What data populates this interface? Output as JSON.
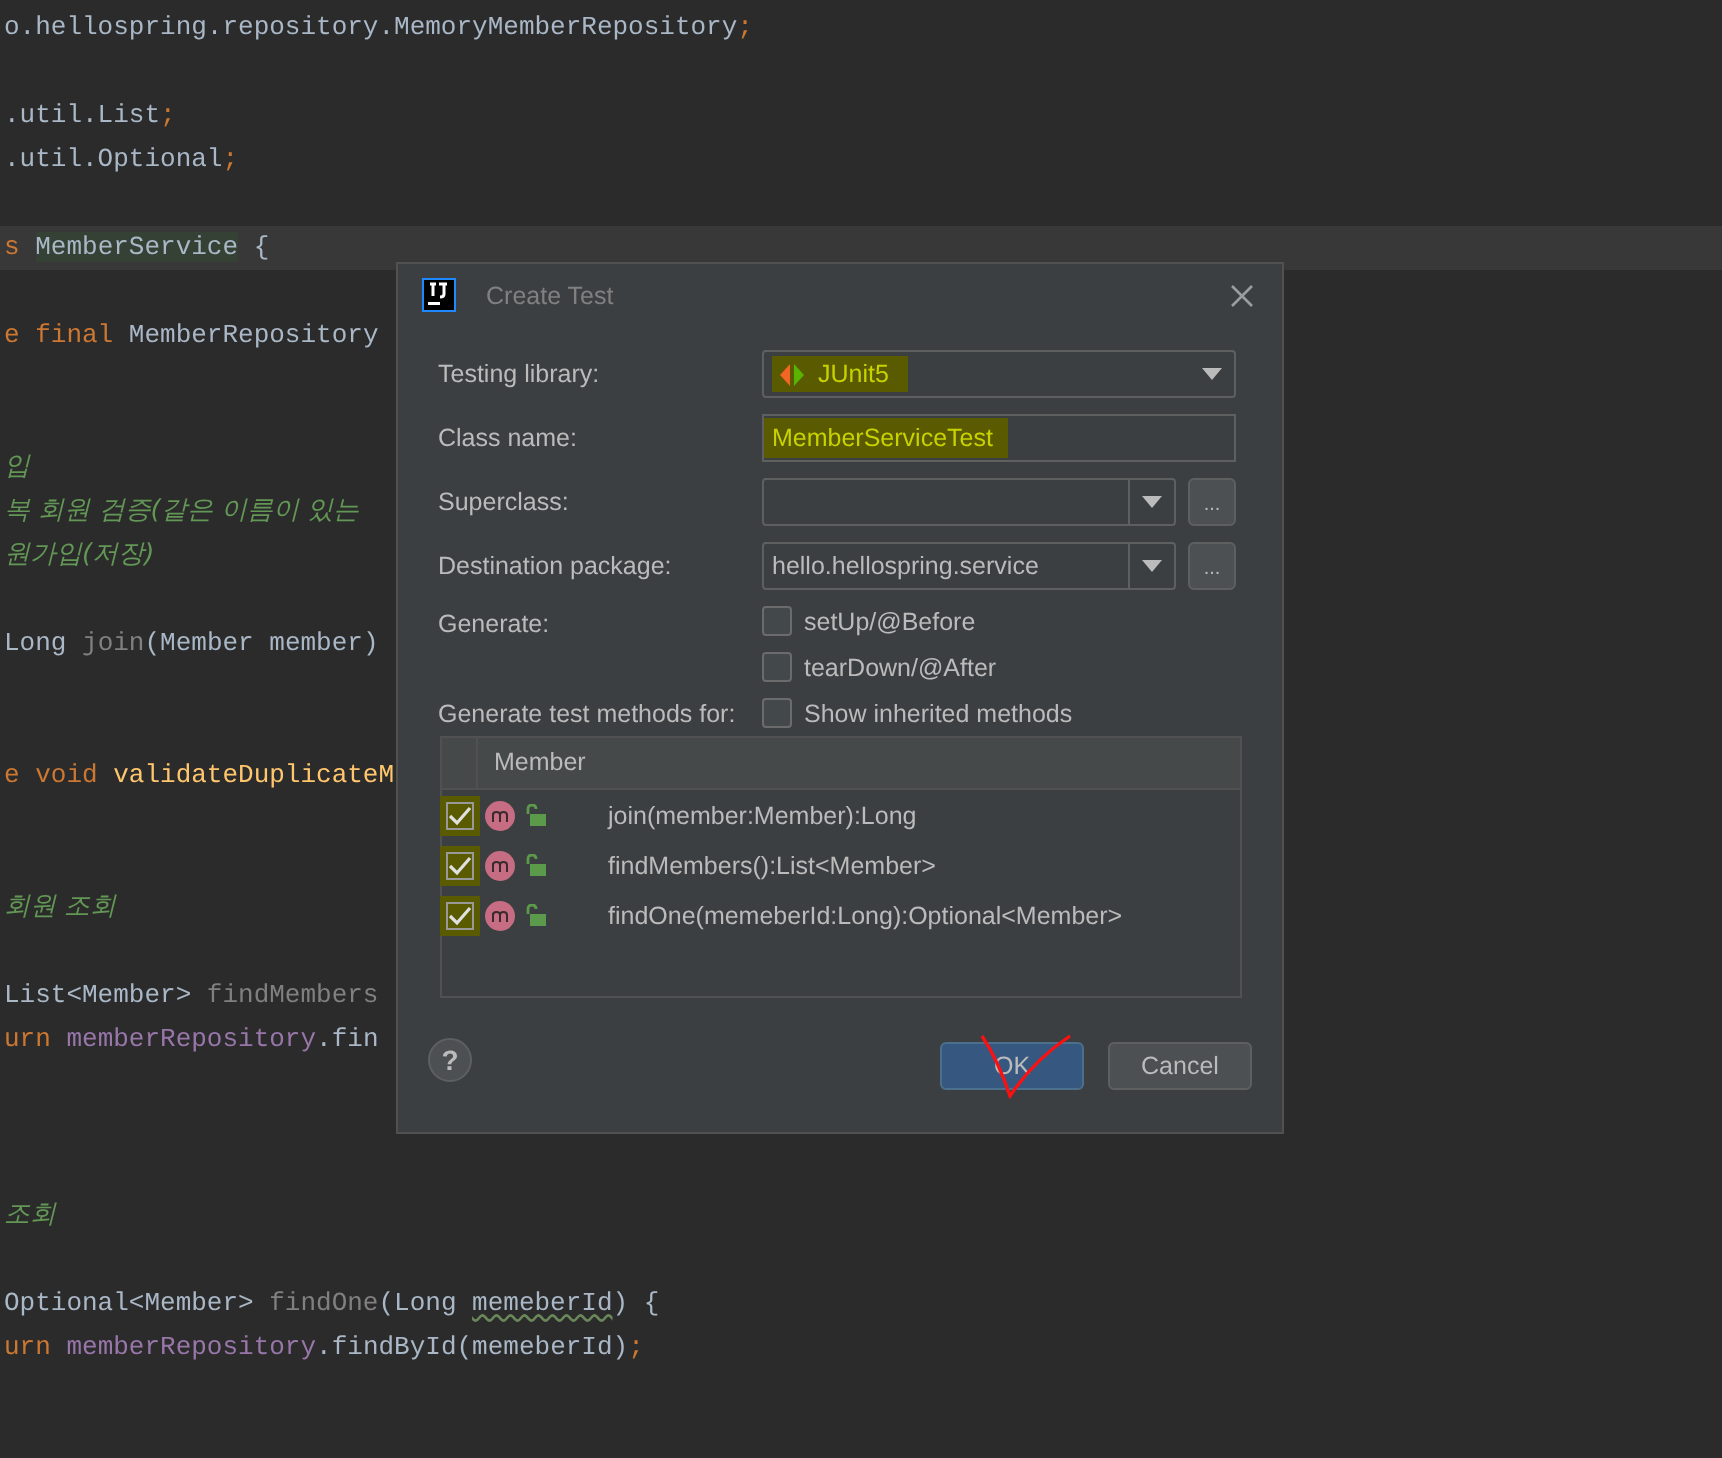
{
  "editor": {
    "lines": [
      {
        "current": false,
        "tokens": [
          {
            "text": "o.hellospring.repository.MemoryMemberRepository",
            "kind": "plain"
          },
          {
            "text": ";",
            "kind": "keyword"
          }
        ]
      },
      {
        "current": false
      },
      {
        "current": false,
        "tokens": [
          {
            "text": ".util.List",
            "kind": "plain"
          },
          {
            "text": ";",
            "kind": "keyword"
          }
        ]
      },
      {
        "current": false,
        "tokens": [
          {
            "text": ".util.Optional",
            "kind": "plain"
          },
          {
            "text": ";",
            "kind": "keyword"
          }
        ]
      },
      {
        "current": false
      },
      {
        "current": true,
        "tokens": [
          {
            "text": "s ",
            "kind": "keyword"
          },
          {
            "text": "MemberService",
            "kind": "marked"
          },
          {
            "text": " {",
            "kind": "plain"
          }
        ]
      },
      {
        "current": false
      },
      {
        "current": false,
        "tokens": [
          {
            "text": "e final ",
            "kind": "keyword"
          },
          {
            "text": "MemberRepository",
            "kind": "plain"
          }
        ]
      },
      {
        "current": false
      },
      {
        "current": false
      },
      {
        "current": false,
        "tokens": [
          {
            "text": "입",
            "kind": "comment"
          }
        ]
      },
      {
        "current": false,
        "tokens": [
          {
            "text": "복 회원 검증(같은 이름이 있는",
            "kind": "comment"
          }
        ]
      },
      {
        "current": false,
        "tokens": [
          {
            "text": "원가입(저장)",
            "kind": "comment"
          }
        ]
      },
      {
        "current": false
      },
      {
        "current": false,
        "tokens": [
          {
            "text": "Long ",
            "kind": "plain"
          },
          {
            "text": "join",
            "kind": "unused"
          },
          {
            "text": "(Member member)",
            "kind": "plain"
          }
        ]
      },
      {
        "current": false
      },
      {
        "current": false
      },
      {
        "current": false,
        "tokens": [
          {
            "text": "e void ",
            "kind": "keyword"
          },
          {
            "text": "validateDuplicateM",
            "kind": "method"
          }
        ]
      },
      {
        "current": false
      },
      {
        "current": false
      },
      {
        "current": false,
        "tokens": [
          {
            "text": "회원 조회",
            "kind": "comment"
          }
        ]
      },
      {
        "current": false
      },
      {
        "current": false,
        "tokens": [
          {
            "text": "List<Member> ",
            "kind": "plain"
          },
          {
            "text": "findMembers",
            "kind": "unused"
          }
        ]
      },
      {
        "current": false,
        "tokens": [
          {
            "text": "urn ",
            "kind": "keyword"
          },
          {
            "text": "memberRepository",
            "kind": "field"
          },
          {
            "text": ".fin",
            "kind": "plain"
          }
        ]
      },
      {
        "current": false
      },
      {
        "current": false
      },
      {
        "current": false
      },
      {
        "current": false,
        "tokens": [
          {
            "text": "조회",
            "kind": "comment"
          }
        ]
      },
      {
        "current": false
      },
      {
        "current": false,
        "tokens": [
          {
            "text": "Optional<Member> ",
            "kind": "plain"
          },
          {
            "text": "findOne",
            "kind": "unused"
          },
          {
            "text": "(Long ",
            "kind": "plain"
          },
          {
            "text": "memeberId",
            "kind": "typo"
          },
          {
            "text": ") {",
            "kind": "plain"
          }
        ]
      },
      {
        "current": false,
        "tokens": [
          {
            "text": "urn ",
            "kind": "keyword"
          },
          {
            "text": "memberRepository",
            "kind": "field"
          },
          {
            "text": ".findById(memeberId)",
            "kind": "plain"
          },
          {
            "text": ";",
            "kind": "keyword"
          }
        ]
      }
    ]
  },
  "dialog": {
    "title": "Create Test",
    "testing_library": {
      "label": "Testing library:",
      "value": "JUnit5"
    },
    "class_name": {
      "label": "Class name:",
      "value": "MemberServiceTest"
    },
    "superclass": {
      "label": "Superclass:",
      "browse": "..."
    },
    "destination_package": {
      "label": "Destination package:",
      "value": "hello.hellospring.service",
      "browse": "..."
    },
    "generate": {
      "label": "Generate:",
      "options": [
        {
          "label": "setUp/@Before",
          "checked": false
        },
        {
          "label": "tearDown/@After",
          "checked": false
        }
      ]
    },
    "methods_label": "Generate test methods for:",
    "show_inherited": {
      "label": "Show inherited methods",
      "checked": false
    },
    "table": {
      "column": "Member",
      "rows": [
        {
          "name": "join(member:Member):Long",
          "checked": true
        },
        {
          "name": "findMembers():List<Member>",
          "checked": true
        },
        {
          "name": "findOne(memeberId:Long):Optional<Member>",
          "checked": true
        }
      ]
    },
    "help": "?",
    "buttons": [
      {
        "label": "OK",
        "kind": "primary"
      },
      {
        "label": "Cancel",
        "kind": "secondary"
      }
    ]
  }
}
